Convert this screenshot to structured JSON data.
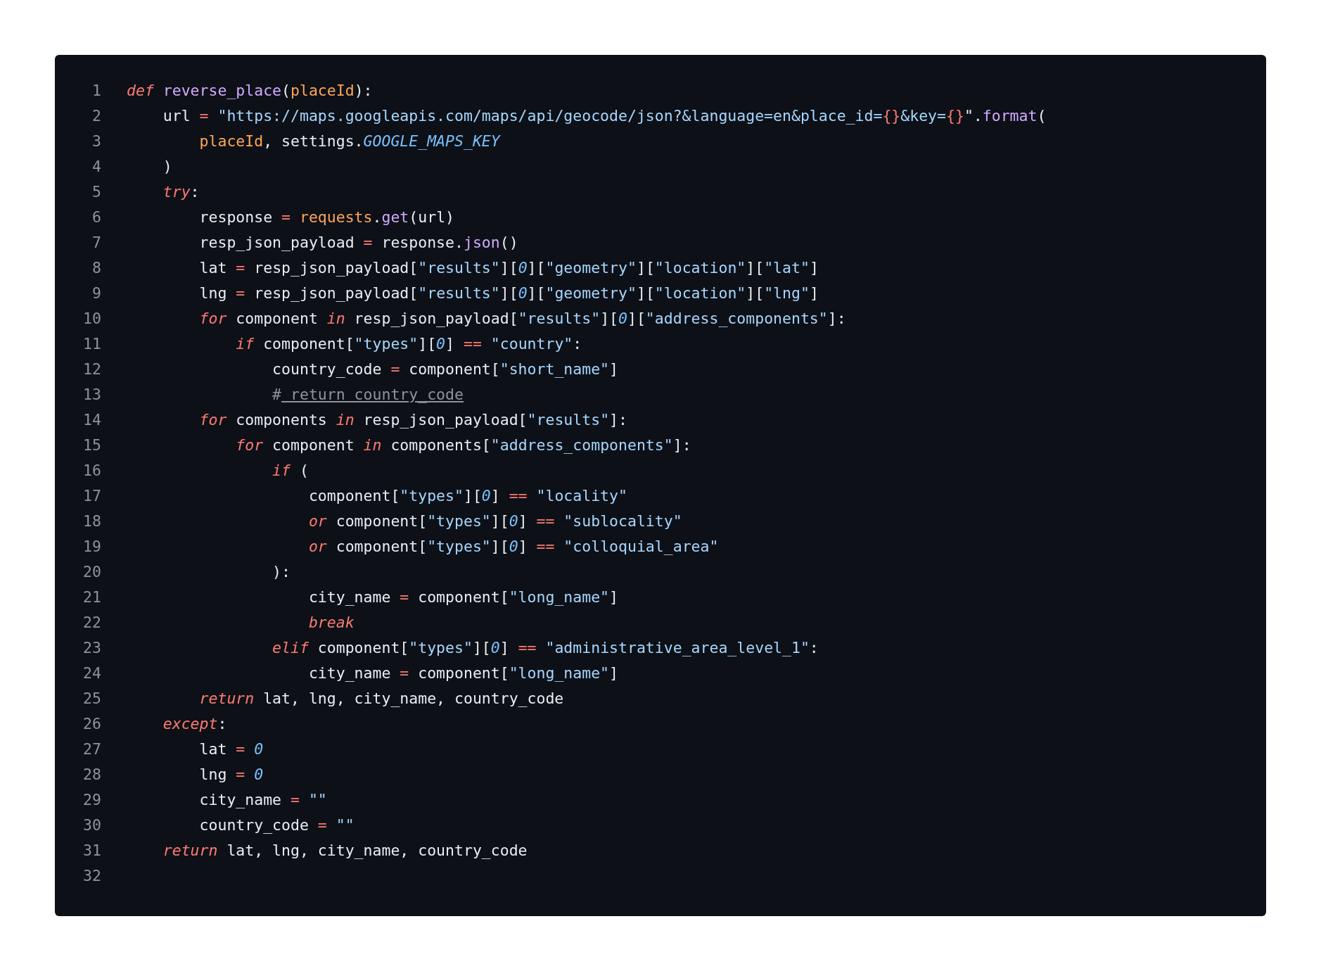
{
  "code_block": {
    "lines": [
      {
        "number": "1",
        "tokens": [
          {
            "kind": "keyword",
            "text": "def "
          },
          {
            "kind": "function",
            "text": "reverse_place"
          },
          {
            "kind": "plain",
            "text": "("
          },
          {
            "kind": "param",
            "text": "placeId"
          },
          {
            "kind": "plain",
            "text": "):"
          }
        ]
      },
      {
        "number": "2",
        "tokens": [
          {
            "kind": "plain",
            "text": "    url "
          },
          {
            "kind": "operator",
            "text": "= "
          },
          {
            "kind": "string",
            "text": "\"https://maps.googleapis.com/maps/api/geocode/json?&language=en&place_id="
          },
          {
            "kind": "escape",
            "text": "{}"
          },
          {
            "kind": "string",
            "text": "&key="
          },
          {
            "kind": "escape",
            "text": "{}"
          },
          {
            "kind": "plain",
            "text": "\"."
          },
          {
            "kind": "function",
            "text": "format"
          },
          {
            "kind": "plain",
            "text": "("
          }
        ]
      },
      {
        "number": "3",
        "tokens": [
          {
            "kind": "param",
            "text": "        placeId"
          },
          {
            "kind": "plain",
            "text": ", settings."
          },
          {
            "kind": "constant",
            "text": "GOOGLE_MAPS_KEY"
          }
        ]
      },
      {
        "number": "4",
        "tokens": [
          {
            "kind": "plain",
            "text": "    )"
          }
        ]
      },
      {
        "number": "5",
        "tokens": [
          {
            "kind": "keyword",
            "text": "    try"
          },
          {
            "kind": "plain",
            "text": ":"
          }
        ]
      },
      {
        "number": "6",
        "tokens": [
          {
            "kind": "plain",
            "text": "        response "
          },
          {
            "kind": "operator",
            "text": "= "
          },
          {
            "kind": "param",
            "text": "requests"
          },
          {
            "kind": "plain",
            "text": "."
          },
          {
            "kind": "function",
            "text": "get"
          },
          {
            "kind": "plain",
            "text": "(url)"
          }
        ]
      },
      {
        "number": "7",
        "tokens": [
          {
            "kind": "plain",
            "text": "        resp_json_payload "
          },
          {
            "kind": "operator",
            "text": "="
          },
          {
            "kind": "plain",
            "text": " response."
          },
          {
            "kind": "function",
            "text": "json"
          },
          {
            "kind": "plain",
            "text": "()"
          }
        ]
      },
      {
        "number": "8",
        "tokens": [
          {
            "kind": "plain",
            "text": "        lat "
          },
          {
            "kind": "operator",
            "text": "="
          },
          {
            "kind": "plain",
            "text": " resp_json_payload["
          },
          {
            "kind": "string",
            "text": "\"results\""
          },
          {
            "kind": "plain",
            "text": "]["
          },
          {
            "kind": "number",
            "text": "0"
          },
          {
            "kind": "plain",
            "text": "]["
          },
          {
            "kind": "string",
            "text": "\"geometry\""
          },
          {
            "kind": "plain",
            "text": "]["
          },
          {
            "kind": "string",
            "text": "\"location\""
          },
          {
            "kind": "plain",
            "text": "]["
          },
          {
            "kind": "string",
            "text": "\"lat\""
          },
          {
            "kind": "plain",
            "text": "]"
          }
        ]
      },
      {
        "number": "9",
        "tokens": [
          {
            "kind": "plain",
            "text": "        lng "
          },
          {
            "kind": "operator",
            "text": "="
          },
          {
            "kind": "plain",
            "text": " resp_json_payload["
          },
          {
            "kind": "string",
            "text": "\"results\""
          },
          {
            "kind": "plain",
            "text": "]["
          },
          {
            "kind": "number",
            "text": "0"
          },
          {
            "kind": "plain",
            "text": "]["
          },
          {
            "kind": "string",
            "text": "\"geometry\""
          },
          {
            "kind": "plain",
            "text": "]["
          },
          {
            "kind": "string",
            "text": "\"location\""
          },
          {
            "kind": "plain",
            "text": "]["
          },
          {
            "kind": "string",
            "text": "\"lng\""
          },
          {
            "kind": "plain",
            "text": "]"
          }
        ]
      },
      {
        "number": "10",
        "tokens": [
          {
            "kind": "keyword",
            "text": "        for"
          },
          {
            "kind": "plain",
            "text": " component "
          },
          {
            "kind": "keyword",
            "text": "in"
          },
          {
            "kind": "plain",
            "text": " resp_json_payload["
          },
          {
            "kind": "string",
            "text": "\"results\""
          },
          {
            "kind": "plain",
            "text": "]["
          },
          {
            "kind": "number",
            "text": "0"
          },
          {
            "kind": "plain",
            "text": "]["
          },
          {
            "kind": "string",
            "text": "\"address_components\""
          },
          {
            "kind": "plain",
            "text": "]:"
          }
        ]
      },
      {
        "number": "11",
        "tokens": [
          {
            "kind": "keyword",
            "text": "            if"
          },
          {
            "kind": "plain",
            "text": " component["
          },
          {
            "kind": "string",
            "text": "\"types\""
          },
          {
            "kind": "plain",
            "text": "]["
          },
          {
            "kind": "number",
            "text": "0"
          },
          {
            "kind": "plain",
            "text": "] "
          },
          {
            "kind": "operator",
            "text": "== "
          },
          {
            "kind": "string",
            "text": "\"country\""
          },
          {
            "kind": "plain",
            "text": ":"
          }
        ]
      },
      {
        "number": "12",
        "tokens": [
          {
            "kind": "plain",
            "text": "                country_code "
          },
          {
            "kind": "operator",
            "text": "="
          },
          {
            "kind": "plain",
            "text": " component["
          },
          {
            "kind": "string",
            "text": "\"short_name\""
          },
          {
            "kind": "plain",
            "text": "]"
          }
        ]
      },
      {
        "number": "13",
        "tokens": [
          {
            "kind": "comment",
            "text": "                #"
          },
          {
            "kind": "comment_link",
            "text": " return country_code"
          }
        ]
      },
      {
        "number": "14",
        "tokens": [
          {
            "kind": "keyword",
            "text": "        for"
          },
          {
            "kind": "plain",
            "text": " components "
          },
          {
            "kind": "keyword",
            "text": "in"
          },
          {
            "kind": "plain",
            "text": " resp_json_payload["
          },
          {
            "kind": "string",
            "text": "\"results\""
          },
          {
            "kind": "plain",
            "text": "]:"
          }
        ]
      },
      {
        "number": "15",
        "tokens": [
          {
            "kind": "keyword",
            "text": "            for"
          },
          {
            "kind": "plain",
            "text": " component "
          },
          {
            "kind": "keyword",
            "text": "in"
          },
          {
            "kind": "plain",
            "text": " components["
          },
          {
            "kind": "string",
            "text": "\"address_components\""
          },
          {
            "kind": "plain",
            "text": "]:"
          }
        ]
      },
      {
        "number": "16",
        "tokens": [
          {
            "kind": "keyword",
            "text": "                if"
          },
          {
            "kind": "plain",
            "text": " ("
          }
        ]
      },
      {
        "number": "17",
        "tokens": [
          {
            "kind": "plain",
            "text": "                    component["
          },
          {
            "kind": "string",
            "text": "\"types\""
          },
          {
            "kind": "plain",
            "text": "]["
          },
          {
            "kind": "number",
            "text": "0"
          },
          {
            "kind": "plain",
            "text": "] "
          },
          {
            "kind": "operator",
            "text": "== "
          },
          {
            "kind": "string",
            "text": "\"locality\""
          }
        ]
      },
      {
        "number": "18",
        "tokens": [
          {
            "kind": "keyword",
            "text": "                    or"
          },
          {
            "kind": "plain",
            "text": " component["
          },
          {
            "kind": "string",
            "text": "\"types\""
          },
          {
            "kind": "plain",
            "text": "]["
          },
          {
            "kind": "number",
            "text": "0"
          },
          {
            "kind": "plain",
            "text": "] "
          },
          {
            "kind": "operator",
            "text": "== "
          },
          {
            "kind": "string",
            "text": "\"sublocality\""
          }
        ]
      },
      {
        "number": "19",
        "tokens": [
          {
            "kind": "keyword",
            "text": "                    or"
          },
          {
            "kind": "plain",
            "text": " component["
          },
          {
            "kind": "string",
            "text": "\"types\""
          },
          {
            "kind": "plain",
            "text": "]["
          },
          {
            "kind": "number",
            "text": "0"
          },
          {
            "kind": "plain",
            "text": "] "
          },
          {
            "kind": "operator",
            "text": "== "
          },
          {
            "kind": "string",
            "text": "\"colloquial_area\""
          }
        ]
      },
      {
        "number": "20",
        "tokens": [
          {
            "kind": "plain",
            "text": "                ):"
          }
        ]
      },
      {
        "number": "21",
        "tokens": [
          {
            "kind": "plain",
            "text": "                    city_name "
          },
          {
            "kind": "operator",
            "text": "="
          },
          {
            "kind": "plain",
            "text": " component["
          },
          {
            "kind": "string",
            "text": "\"long_name\""
          },
          {
            "kind": "plain",
            "text": "]"
          }
        ]
      },
      {
        "number": "22",
        "tokens": [
          {
            "kind": "keyword",
            "text": "                    break"
          }
        ]
      },
      {
        "number": "23",
        "tokens": [
          {
            "kind": "keyword",
            "text": "                elif"
          },
          {
            "kind": "plain",
            "text": " component["
          },
          {
            "kind": "string",
            "text": "\"types\""
          },
          {
            "kind": "plain",
            "text": "]["
          },
          {
            "kind": "number",
            "text": "0"
          },
          {
            "kind": "plain",
            "text": "] "
          },
          {
            "kind": "operator",
            "text": "== "
          },
          {
            "kind": "string",
            "text": "\"administrative_area_level_1\""
          },
          {
            "kind": "plain",
            "text": ":"
          }
        ]
      },
      {
        "number": "24",
        "tokens": [
          {
            "kind": "plain",
            "text": "                    city_name "
          },
          {
            "kind": "operator",
            "text": "="
          },
          {
            "kind": "plain",
            "text": " component["
          },
          {
            "kind": "string",
            "text": "\"long_name\""
          },
          {
            "kind": "plain",
            "text": "]"
          }
        ]
      },
      {
        "number": "25",
        "tokens": [
          {
            "kind": "keyword",
            "text": "        return"
          },
          {
            "kind": "plain",
            "text": " lat, lng, city_name, country_code"
          }
        ]
      },
      {
        "number": "26",
        "tokens": [
          {
            "kind": "keyword",
            "text": "    except"
          },
          {
            "kind": "plain",
            "text": ":"
          }
        ]
      },
      {
        "number": "27",
        "tokens": [
          {
            "kind": "plain",
            "text": "        lat "
          },
          {
            "kind": "operator",
            "text": "= "
          },
          {
            "kind": "number",
            "text": "0"
          }
        ]
      },
      {
        "number": "28",
        "tokens": [
          {
            "kind": "plain",
            "text": "        lng "
          },
          {
            "kind": "operator",
            "text": "= "
          },
          {
            "kind": "number",
            "text": "0"
          }
        ]
      },
      {
        "number": "29",
        "tokens": [
          {
            "kind": "plain",
            "text": "        city_name "
          },
          {
            "kind": "operator",
            "text": "= "
          },
          {
            "kind": "string",
            "text": "\"\""
          }
        ]
      },
      {
        "number": "30",
        "tokens": [
          {
            "kind": "plain",
            "text": "        country_code "
          },
          {
            "kind": "operator",
            "text": "= "
          },
          {
            "kind": "string",
            "text": "\"\""
          }
        ]
      },
      {
        "number": "31",
        "tokens": [
          {
            "kind": "keyword",
            "text": "    return"
          },
          {
            "kind": "plain",
            "text": " lat, lng, city_name, country_code"
          }
        ]
      },
      {
        "number": "32"
      }
    ]
  }
}
